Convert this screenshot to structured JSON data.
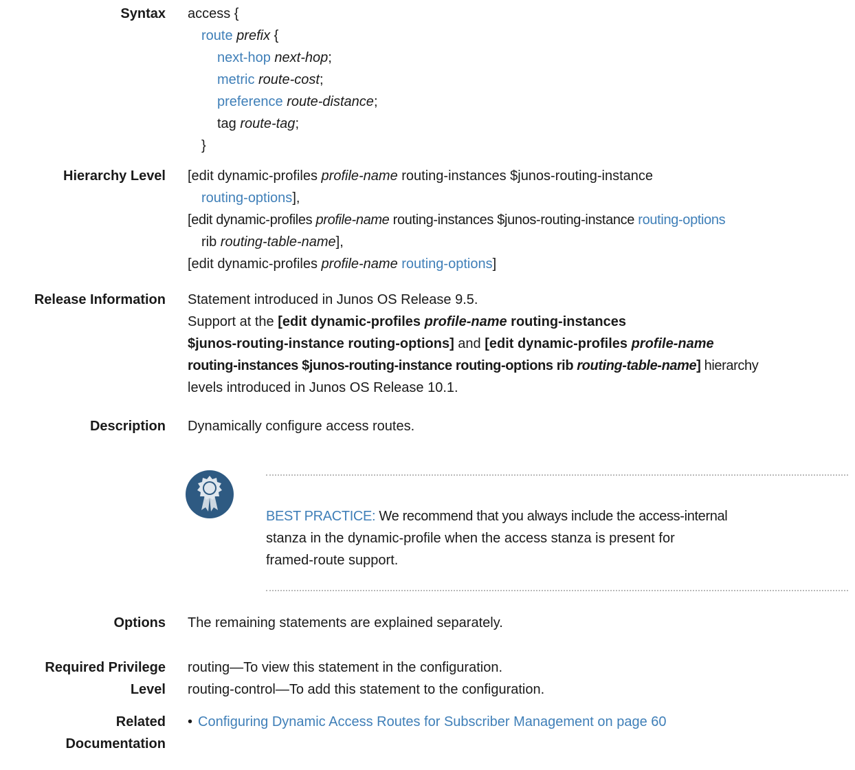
{
  "syntax": {
    "label": "Syntax",
    "access": "access {",
    "route": "route",
    "prefix": "prefix",
    "open_brace": " {",
    "next_hop_kw": "next-hop",
    "next_hop_val": "next-hop",
    "metric_kw": "metric",
    "metric_val": "route-cost",
    "preference_kw": "preference",
    "preference_val": "route-distance",
    "tag_kw": "tag",
    "tag_val": "route-tag",
    "semicolon": ";",
    "close_brace": "}"
  },
  "hierarchy": {
    "label": "Hierarchy Level",
    "l1_a": "[edit dynamic-profiles ",
    "profile_name": "profile-name",
    "l1_b": " routing-instances $junos-routing-instance",
    "routing_options": "routing-options",
    "l2_end": "],",
    "l3_a": "[edit dynamic-profiles ",
    "l3_b": " routing-instances $junos-routing-instance ",
    "l4_a": "rib ",
    "routing_table_name": "routing-table-name",
    "l4_end": "],",
    "l5_a": "[edit dynamic-profiles ",
    "l5_b": " ",
    "l5_end": "]"
  },
  "release": {
    "label": "Release Information",
    "line1": "Statement introduced in Junos OS Release 9.5.",
    "l2_a": "Support at the ",
    "l2_b": "[edit dynamic-profiles ",
    "profile_name": "profile-name",
    "l2_c": " routing-instances",
    "l3_a": "$junos-routing-instance routing-options]",
    "l3_b": " and ",
    "l3_c": "[edit dynamic-profiles ",
    "l4_a": "routing-instances $junos-routing-instance routing-options rib ",
    "routing_table_name": "routing-table-name",
    "l4_b": "]",
    "l4_c": " hierarchy",
    "line5": "levels introduced in Junos OS Release 10.1."
  },
  "description": {
    "label": "Description",
    "text": "Dynamically configure access routes."
  },
  "best_practice": {
    "heading": "BEST PRACTICE:",
    "t1": " We recommend that you always include the ",
    "access_internal": "access-internal",
    "t2": "stanza in the dynamic-profile when the ",
    "access": "access",
    "t3": " stanza is present for",
    "t4": "framed-route support.",
    "icon": "best-practice-ribbon-icon",
    "icon_color": "#2e5a82"
  },
  "options": {
    "label": "Options",
    "text": "The remaining statements are explained separately."
  },
  "privilege": {
    "label_1": "Required Privilege",
    "label_2": "Level",
    "line1": "routing—To view this statement in the configuration.",
    "line2": "routing-control—To add this statement to the configuration."
  },
  "related": {
    "label_1": "Related",
    "label_2": "Documentation",
    "bullet": "•",
    "link": "Configuring Dynamic Access Routes for Subscriber Management on page 60"
  },
  "colors": {
    "link": "#3f7fb8",
    "text": "#1a1a1a",
    "divider": "#b9b9b9"
  }
}
